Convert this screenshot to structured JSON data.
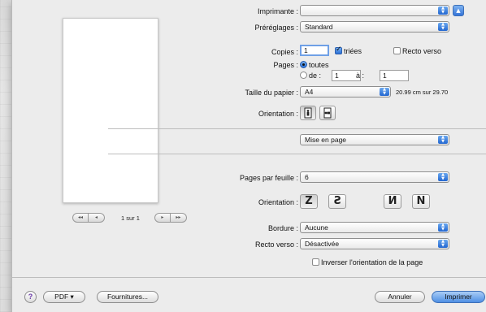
{
  "printer": {
    "label": "Imprimante :",
    "value": ""
  },
  "presets": {
    "label": "Préréglages :",
    "value": "Standard"
  },
  "copies": {
    "label": "Copies :",
    "value": "1",
    "collate_label": "triées",
    "collate_checked": true,
    "duplex_label": "Recto verso",
    "duplex_checked": false
  },
  "pages": {
    "label": "Pages :",
    "all_label": "toutes",
    "from_label": "de :",
    "from_value": "1",
    "to_label": "à :",
    "to_value": "1"
  },
  "paper": {
    "label": "Taille du papier :",
    "value": "A4",
    "size_text": "20.99 cm sur 29.70"
  },
  "orientation": {
    "label": "Orientation :"
  },
  "section_menu": {
    "value": "Mise en page"
  },
  "layout": {
    "pages_per_sheet_label": "Pages par feuille :",
    "pages_per_sheet_value": "6",
    "orientation_label": "Orientation :",
    "direction_glyphs": [
      "Z",
      "S",
      "N",
      "N"
    ],
    "border_label": "Bordure :",
    "border_value": "Aucune",
    "duplex_label": "Recto verso :",
    "duplex_value": "Désactivée",
    "reverse_label": "Inverser l'orientation de la page",
    "reverse_checked": false
  },
  "preview": {
    "page_text": "1 sur 1",
    "prev_glyphs": [
      "◂◂",
      "◂"
    ],
    "next_glyphs": [
      "▸",
      "▸▸"
    ]
  },
  "footer": {
    "help_glyph": "?",
    "pdf_label": "PDF ▾",
    "supplies_label": "Fournitures...",
    "cancel_label": "Annuler",
    "print_label": "Imprimer"
  },
  "colors": {
    "accent": "#2f6fd6",
    "sheet_bg": "#ececec"
  }
}
